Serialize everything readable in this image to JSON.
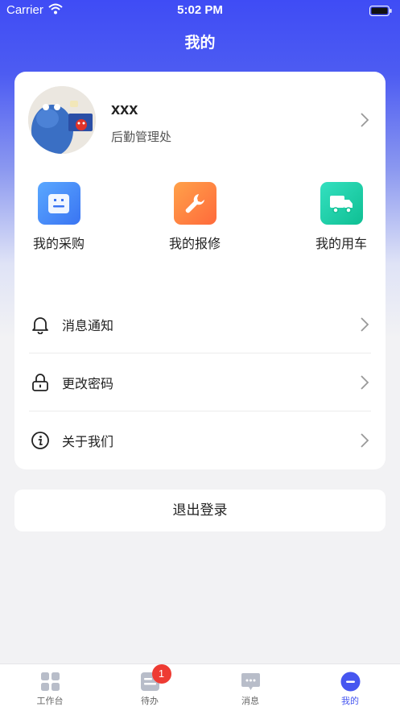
{
  "status_bar": {
    "carrier": "Carrier",
    "time": "5:02 PM"
  },
  "page": {
    "title": "我的"
  },
  "profile": {
    "name": "xxx",
    "department": "后勤管理处"
  },
  "quick_actions": [
    {
      "label": "我的采购",
      "icon": "document-icon",
      "color": "#3a74f2"
    },
    {
      "label": "我的报修",
      "icon": "wrench-icon",
      "color": "#ff6a3b"
    },
    {
      "label": "我的用车",
      "icon": "truck-icon",
      "color": "#0fbf93"
    }
  ],
  "menu": [
    {
      "label": "消息通知",
      "icon": "bell-icon"
    },
    {
      "label": "更改密码",
      "icon": "lock-icon"
    },
    {
      "label": "关于我们",
      "icon": "info-icon"
    }
  ],
  "logout": {
    "label": "退出登录"
  },
  "tab_bar": {
    "tabs": [
      {
        "label": "工作台",
        "icon": "grid-icon",
        "active": false
      },
      {
        "label": "待办",
        "icon": "todo-icon",
        "active": false,
        "badge": "1"
      },
      {
        "label": "消息",
        "icon": "chat-icon",
        "active": false
      },
      {
        "label": "我的",
        "icon": "user-icon",
        "active": true
      }
    ],
    "active_color": "#4656f0"
  }
}
